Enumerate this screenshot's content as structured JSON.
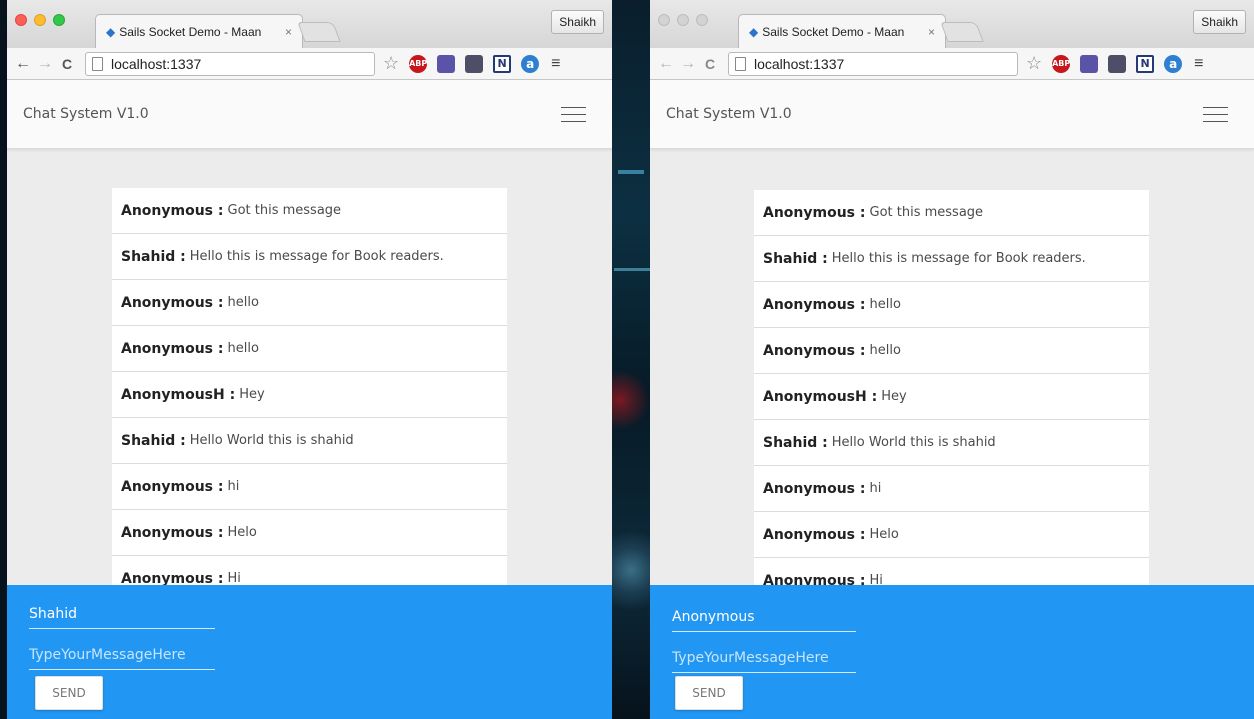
{
  "browser": {
    "tab_title": "Sails Socket Demo - Maan",
    "tab_icon": "sails-icon",
    "tab_close": "×",
    "profile_name": "Shaikh",
    "url": "localhost:1337",
    "nav_back": "←",
    "nav_forward": "→",
    "nav_reload": "C",
    "star": "☆",
    "extensions": {
      "abp": "ABP",
      "n": "N",
      "a": "a"
    },
    "menu": "≡"
  },
  "app": {
    "brand": "Chat System V1.0"
  },
  "messages": [
    {
      "author": "Anonymous :",
      "text": "Got this message"
    },
    {
      "author": "Shahid :",
      "text": "Hello this is message for Book readers."
    },
    {
      "author": "Anonymous :",
      "text": "hello"
    },
    {
      "author": "Anonymous :",
      "text": "hello"
    },
    {
      "author": "AnonymousH :",
      "text": "Hey"
    },
    {
      "author": "Shahid :",
      "text": "Hello World this is shahid"
    },
    {
      "author": "Anonymous :",
      "text": "hi"
    },
    {
      "author": "Anonymous :",
      "text": "Helo"
    },
    {
      "author": "Anonymous :",
      "text": "Hi"
    }
  ],
  "left_window": {
    "name_value": "Shahid",
    "message_placeholder": "TypeYourMessageHere",
    "send_label": "SEND"
  },
  "right_window": {
    "name_value": "Anonymous",
    "message_placeholder": "TypeYourMessageHere",
    "send_label": "SEND"
  },
  "colors": {
    "composer": "#2196f3",
    "appbar": "#fafafa",
    "page_bg": "#ececec"
  }
}
